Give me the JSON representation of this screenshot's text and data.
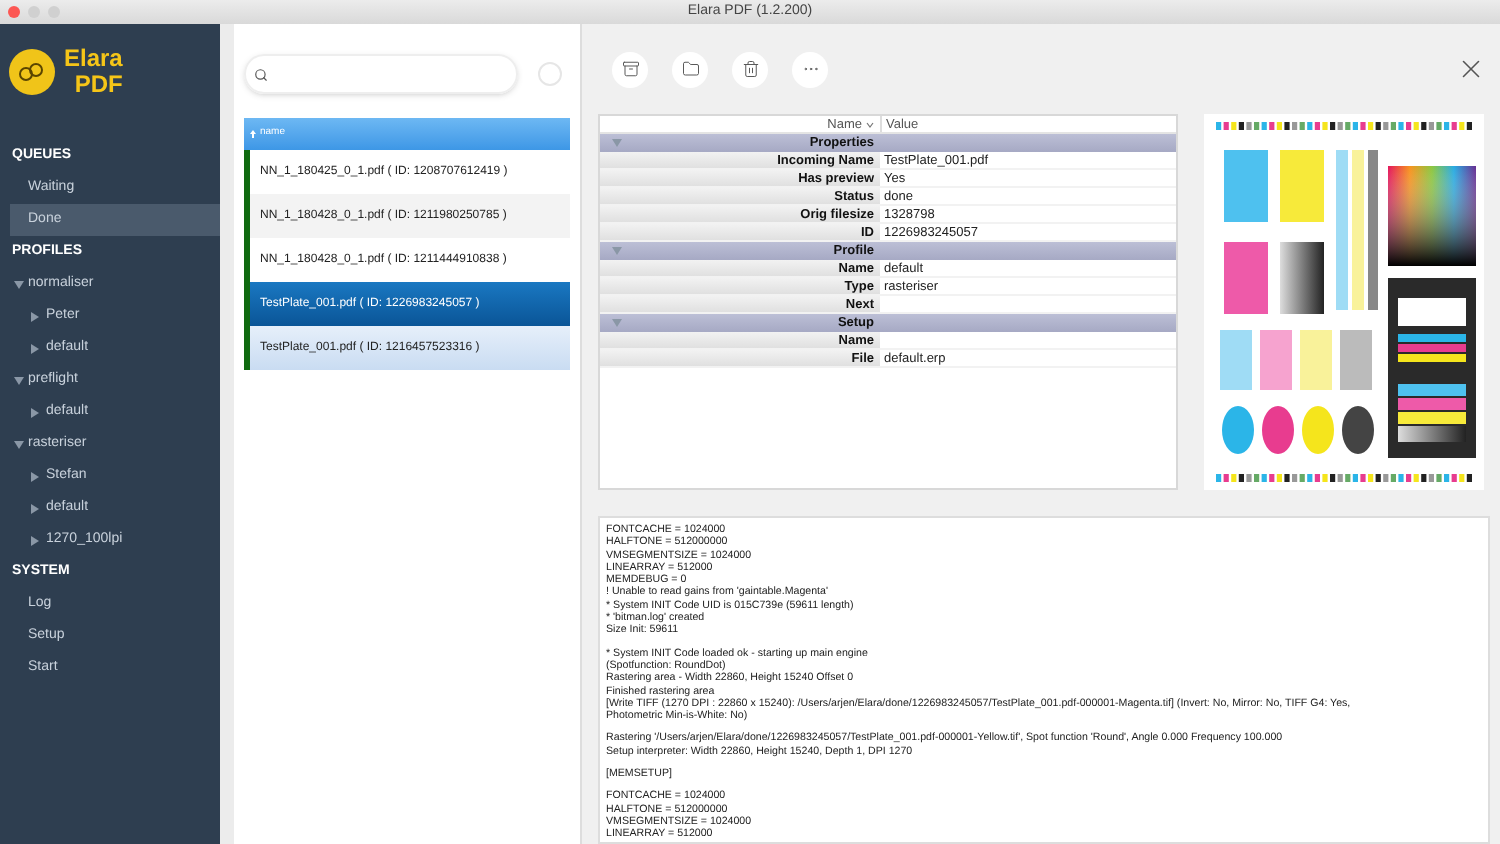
{
  "window": {
    "title": "Elara PDF (1.2.200)"
  },
  "logo": {
    "line_1": "Elara",
    "line_2": "PDF"
  },
  "sidebar": {
    "sections": [
      {
        "title": "QUEUES",
        "items": [
          {
            "label": "Waiting",
            "selected": false
          },
          {
            "label": "Done",
            "selected": true
          }
        ]
      },
      {
        "title": "PROFILES",
        "items": [
          {
            "label": "normaliser",
            "expanded": true,
            "children": [
              {
                "label": "Peter"
              },
              {
                "label": "default"
              }
            ]
          },
          {
            "label": "preflight",
            "expanded": true,
            "children": [
              {
                "label": "default"
              }
            ]
          },
          {
            "label": "rasteriser",
            "expanded": true,
            "children": [
              {
                "label": "Stefan"
              },
              {
                "label": "default"
              },
              {
                "label": "1270_100lpi"
              }
            ]
          }
        ]
      },
      {
        "title": "SYSTEM",
        "items": [
          {
            "label": "Log",
            "selected": false
          },
          {
            "label": "Setup",
            "selected": false
          },
          {
            "label": "Start",
            "selected": false
          }
        ]
      }
    ]
  },
  "job_list": {
    "column": "name",
    "rows": [
      {
        "label": "NN_1_180425_0_1.pdf ( ID: 1208707612419 )",
        "selected": false,
        "highlighted": false
      },
      {
        "label": "NN_1_180428_0_1.pdf ( ID: 1211980250785 )",
        "selected": false,
        "highlighted": false
      },
      {
        "label": "NN_1_180428_0_1.pdf ( ID: 1211444910838 )",
        "selected": false,
        "highlighted": false
      },
      {
        "label": "TestPlate_001.pdf ( ID: 1226983245057 )",
        "selected": true,
        "highlighted": false
      },
      {
        "label": "TestPlate_001.pdf ( ID: 1216457523316 )",
        "selected": false,
        "highlighted": true
      }
    ]
  },
  "properties": {
    "columns": [
      "Name",
      "Value"
    ],
    "groups": [
      {
        "title": "Properties",
        "rows": [
          {
            "name": "Incoming Name",
            "value": "TestPlate_001.pdf"
          },
          {
            "name": "Has preview",
            "value": "Yes"
          },
          {
            "name": "Status",
            "value": "done"
          },
          {
            "name": "Orig filesize",
            "value": "1328798"
          },
          {
            "name": "ID",
            "value": "1226983245057"
          }
        ]
      },
      {
        "title": "Profile",
        "rows": [
          {
            "name": "Name",
            "value": "default"
          },
          {
            "name": "Type",
            "value": "rasteriser"
          },
          {
            "name": "Next"
          }
        ]
      },
      {
        "title": "Setup",
        "rows": [
          {
            "name": "Name"
          },
          {
            "name": "File",
            "value": "default.erp"
          }
        ]
      }
    ]
  },
  "log": {
    "blocks": [
      [
        "FONTCACHE = 1024000",
        "HALFTONE = 512000000",
        "VMSEGMENTSIZE = 1024000",
        "LINEARRAY = 512000",
        "MEMDEBUG = 0",
        "! Unable to read gains from 'gaintable.Magenta'",
        "* System INIT Code UID is 015C739e (59611 length)",
        "* 'bitman.log' created",
        "Size Init: 59611"
      ],
      [
        "* System INIT Code loaded ok - starting up main engine",
        "(Spotfunction: RoundDot)",
        "Rastering area - Width 22860, Height 15240 Offset 0",
        "Finished rastering area",
        "[Write TIFF (1270 DPI : 22860 x 15240): /Users/arjen/Elara/done/1226983245057/TestPlate_001.pdf-000001-Magenta.tif] (Invert: No, Mirror: No, TIFF G4: Yes,",
        "Photometric Min-is-White: No)"
      ],
      [
        "Rastering '/Users/arjen/Elara/done/1226983245057/TestPlate_001.pdf-000001-Yellow.tif', Spot function 'Round', Angle 0.000 Frequency 100.000",
        "Setup interpreter: Width 22860, Height 15240, Depth 1, DPI 1270"
      ],
      [
        "[MEMSETUP]"
      ],
      [
        "FONTCACHE = 1024000",
        "HALFTONE = 512000000",
        "VMSEGMENTSIZE = 1024000",
        "LINEARRAY = 512000"
      ]
    ]
  }
}
